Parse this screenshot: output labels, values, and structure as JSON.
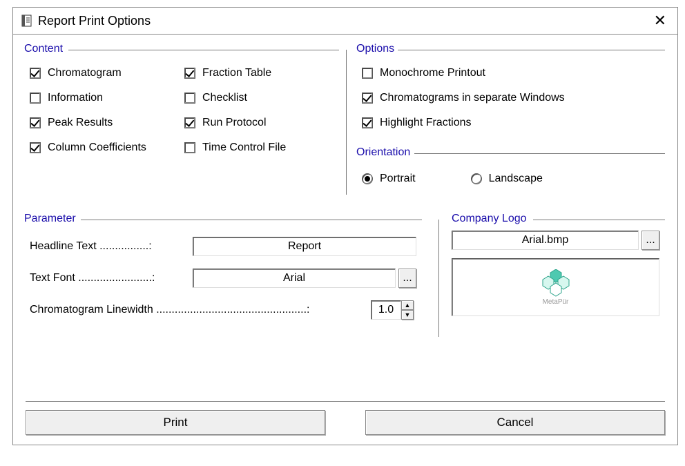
{
  "window": {
    "title": "Report Print Options"
  },
  "content": {
    "legend": "Content",
    "col1": [
      {
        "label": "Chromatogram",
        "checked": true
      },
      {
        "label": "Information",
        "checked": false
      },
      {
        "label": "Peak Results",
        "checked": true
      },
      {
        "label": "Column Coefficients",
        "checked": true
      }
    ],
    "col2": [
      {
        "label": "Fraction Table",
        "checked": true
      },
      {
        "label": "Checklist",
        "checked": false
      },
      {
        "label": "Run Protocol",
        "checked": true
      },
      {
        "label": "Time Control File",
        "checked": false
      }
    ]
  },
  "options": {
    "legend": "Options",
    "items": [
      {
        "label": "Monochrome Printout",
        "checked": false
      },
      {
        "label": "Chromatograms in separate Windows",
        "checked": true
      },
      {
        "label": "Highlight Fractions",
        "checked": true
      }
    ]
  },
  "orientation": {
    "legend": "Orientation",
    "portrait": "Portrait",
    "landscape": "Landscape",
    "selected": "portrait"
  },
  "parameter": {
    "legend": "Parameter",
    "headline_label": "Headline Text ................:",
    "headline_value": "Report",
    "font_label": "Text Font ........................:",
    "font_value": "Arial",
    "linewidth_label": "Chromatogram Linewidth .................................................:",
    "linewidth_value": "1.0",
    "browse": "..."
  },
  "logo": {
    "legend": "Company Logo",
    "path": "Arial.bmp",
    "browse": "...",
    "preview_text": "MetaPür"
  },
  "buttons": {
    "print": "Print",
    "cancel": "Cancel"
  }
}
